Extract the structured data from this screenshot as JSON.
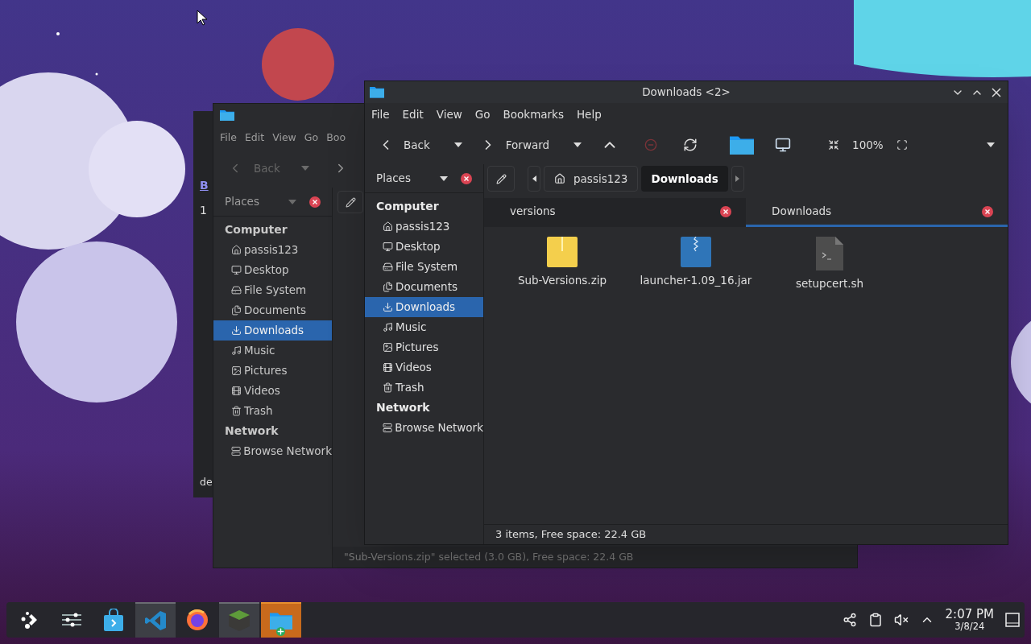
{
  "partial_window": {
    "link": "B",
    "line_1": "1",
    "line_2": "de"
  },
  "back_window": {
    "menu": [
      "File",
      "Edit",
      "View",
      "Go",
      "Boo"
    ],
    "toolbar": {
      "back": "Back",
      "back_disabled": true
    },
    "places_label": "Places",
    "sidebar": [
      {
        "title": "Computer",
        "items": [
          {
            "kind": "home",
            "label": "passis123",
            "selected": false
          },
          {
            "kind": "desktop",
            "label": "Desktop",
            "selected": false
          },
          {
            "kind": "drive",
            "label": "File System",
            "selected": false
          },
          {
            "kind": "documents",
            "label": "Documents",
            "selected": false
          },
          {
            "kind": "downloads",
            "label": "Downloads",
            "selected": true
          },
          {
            "kind": "music",
            "label": "Music",
            "selected": false
          },
          {
            "kind": "pictures",
            "label": "Pictures",
            "selected": false
          },
          {
            "kind": "videos",
            "label": "Videos",
            "selected": false
          },
          {
            "kind": "trash",
            "label": "Trash",
            "selected": false
          }
        ]
      },
      {
        "title": "Network",
        "items": [
          {
            "kind": "network",
            "label": "Browse Network",
            "selected": false
          }
        ]
      }
    ],
    "status_bar": "\"Sub-Versions.zip\" selected (3.0 GB), Free space: 22.4 GB"
  },
  "front_window": {
    "title": "Downloads <2>",
    "menu": [
      "File",
      "Edit",
      "View",
      "Go",
      "Bookmarks",
      "Help"
    ],
    "toolbar": {
      "back": "Back",
      "forward": "Forward",
      "zoom": "100%"
    },
    "places_label": "Places",
    "sidebar": [
      {
        "title": "Computer",
        "items": [
          {
            "kind": "home",
            "label": "passis123",
            "selected": false
          },
          {
            "kind": "desktop",
            "label": "Desktop",
            "selected": false
          },
          {
            "kind": "drive",
            "label": "File System",
            "selected": false
          },
          {
            "kind": "documents",
            "label": "Documents",
            "selected": false
          },
          {
            "kind": "downloads",
            "label": "Downloads",
            "selected": true
          },
          {
            "kind": "music",
            "label": "Music",
            "selected": false
          },
          {
            "kind": "pictures",
            "label": "Pictures",
            "selected": false
          },
          {
            "kind": "videos",
            "label": "Videos",
            "selected": false
          },
          {
            "kind": "trash",
            "label": "Trash",
            "selected": false
          }
        ]
      },
      {
        "title": "Network",
        "items": [
          {
            "kind": "network",
            "label": "Browse Network",
            "selected": false
          }
        ]
      }
    ],
    "path": [
      {
        "kind": "home",
        "label": "passis123",
        "selected": false
      },
      {
        "kind": "folder",
        "label": "Downloads",
        "selected": true
      }
    ],
    "tabs": [
      {
        "label": "versions",
        "selected": false
      },
      {
        "label": "Downloads",
        "selected": true
      }
    ],
    "files": [
      {
        "kind": "zip",
        "name": "Sub-Versions.zip"
      },
      {
        "kind": "jar",
        "name": "launcher-1.09_16.jar"
      },
      {
        "kind": "script",
        "name": "setupcert.sh"
      }
    ],
    "status_bar": "3 items, Free space: 22.4 GB"
  },
  "taskbar": {
    "apps": [
      {
        "kind": "launcher",
        "open": false,
        "selected": false
      },
      {
        "kind": "settings",
        "open": false,
        "selected": false
      },
      {
        "kind": "store",
        "open": false,
        "selected": false
      },
      {
        "kind": "code",
        "open": true,
        "selected": false
      },
      {
        "kind": "browser",
        "open": false,
        "selected": false
      },
      {
        "kind": "game",
        "open": true,
        "selected": false
      },
      {
        "kind": "files",
        "open": true,
        "selected": true
      }
    ],
    "time": "2:07 PM",
    "date": "3/8/24"
  }
}
